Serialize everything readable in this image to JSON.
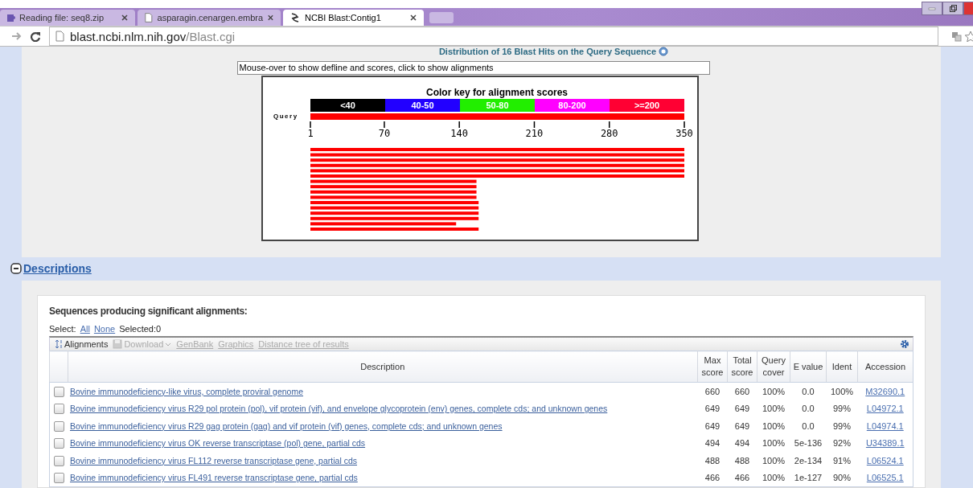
{
  "browser": {
    "tabs": [
      {
        "title": "Reading file: seq8.zip",
        "selected": false,
        "kind": "puzzle"
      },
      {
        "title": "asparagin.cenargen.embra",
        "selected": false,
        "kind": "page"
      },
      {
        "title": "NCBI Blast:Contig1",
        "selected": true,
        "kind": "helix"
      }
    ],
    "address": {
      "host": "blast.ncbi.nlm.nih.gov",
      "path": "/Blast.cgi"
    }
  },
  "graphic": {
    "title": "Distribution of 16 Blast Hits on the Query Sequence",
    "hint": "Mouse-over to show defline and scores, click to show alignments",
    "color_key": {
      "title": "Color key for alignment scores",
      "ranges": [
        {
          "label": "<40",
          "color": "#000000"
        },
        {
          "label": "40-50",
          "color": "#2200ff"
        },
        {
          "label": "50-80",
          "color": "#22ee00"
        },
        {
          "label": "80-200",
          "color": "#ff00ff"
        },
        {
          "label": ">=200",
          "color": "#ff0033"
        }
      ]
    },
    "query_label": "Query",
    "chart_data": {
      "type": "bar",
      "orientation": "horizontal",
      "xlim": [
        1,
        350
      ],
      "xticks": [
        1,
        70,
        140,
        210,
        280,
        350
      ],
      "series": [
        {
          "color": "#ff0000",
          "values": [
            350,
            350,
            350,
            350,
            350,
            350,
            156,
            156,
            156,
            156,
            158,
            158,
            158,
            158,
            137,
            158
          ]
        }
      ]
    }
  },
  "descriptions": {
    "heading": "Descriptions",
    "expanded": true,
    "panel_title": "Sequences producing significant alignments:",
    "select_label": "Select:",
    "select_links": [
      "All",
      "None"
    ],
    "selected_count": "Selected:0",
    "toolbar": [
      {
        "label": "Alignments",
        "enabled": true,
        "kind": "sort"
      },
      {
        "label": "Download",
        "enabled": false,
        "kind": "download"
      },
      {
        "label": "GenBank",
        "enabled": false,
        "kind": "link"
      },
      {
        "label": "Graphics",
        "enabled": false,
        "kind": "link"
      },
      {
        "label": "Distance tree of results",
        "enabled": false,
        "kind": "link"
      }
    ],
    "columns": [
      "Description",
      "Max score",
      "Total score",
      "Query cover",
      "E value",
      "Ident",
      "Accession"
    ],
    "rows": [
      {
        "checked": false,
        "description": "Bovine immunodeficiency-like virus, complete proviral genome",
        "max": "660",
        "total": "660",
        "cover": "100%",
        "evalue": "0.0",
        "ident": "100%",
        "accession": "M32690.1"
      },
      {
        "checked": false,
        "description": "Bovine immunodeficiency virus R29 pol protein (pol), vif protein (vif), and envelope glycoprotein (env) genes, complete cds; and unknown genes",
        "max": "649",
        "total": "649",
        "cover": "100%",
        "evalue": "0.0",
        "ident": "99%",
        "accession": "L04972.1"
      },
      {
        "checked": false,
        "description": "Bovine immunodeficiency virus R29 gag protein (gag) and vif protein (vif) genes, complete cds; and unknown genes",
        "max": "649",
        "total": "649",
        "cover": "100%",
        "evalue": "0.0",
        "ident": "99%",
        "accession": "L04974.1"
      },
      {
        "checked": false,
        "description": "Bovine immunodeficiency virus OK reverse transcriptase (pol) gene, partial cds",
        "max": "494",
        "total": "494",
        "cover": "100%",
        "evalue": "5e-136",
        "ident": "92%",
        "accession": "U34389.1"
      },
      {
        "checked": false,
        "description": "Bovine immunodeficiency virus FL112 reverse transcriptase gene, partial cds",
        "max": "488",
        "total": "488",
        "cover": "100%",
        "evalue": "2e-134",
        "ident": "91%",
        "accession": "L06524.1"
      },
      {
        "checked": false,
        "description": "Bovine immunodeficiency virus FL491 reverse transcriptase gene, partial cds",
        "max": "466",
        "total": "466",
        "cover": "100%",
        "evalue": "1e-127",
        "ident": "90%",
        "accession": "L06525.1"
      }
    ]
  }
}
